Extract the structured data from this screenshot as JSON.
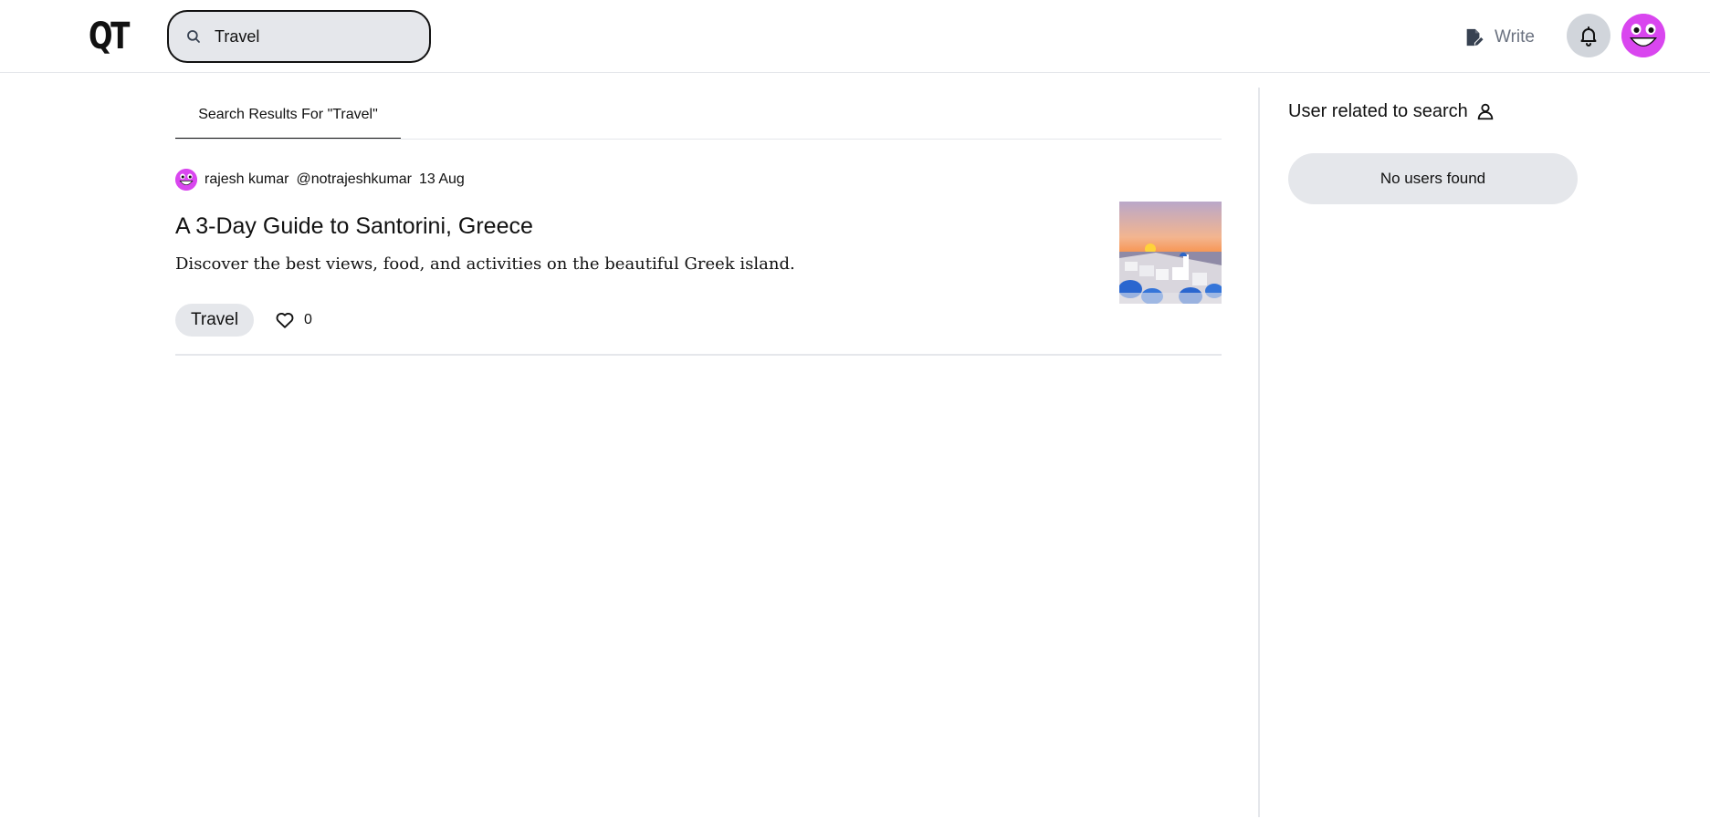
{
  "header": {
    "logo": "QT",
    "search": {
      "value": "Travel",
      "icon": "search-icon"
    },
    "write_label": "Write",
    "notifications_icon": "bell-icon",
    "avatar_icon": "smiley-avatar",
    "avatar_color": "#d946ef"
  },
  "main": {
    "tab_label": "Search Results For \"Travel\"",
    "post": {
      "author_name": "rajesh kumar",
      "author_handle": "@notrajeshkumar",
      "date": "13 Aug",
      "title": "A 3-Day Guide to Santorini, Greece",
      "description": "Discover the best views, food, and activities on the beautiful Greek island.",
      "tag": "Travel",
      "likes": "0"
    }
  },
  "sidebar": {
    "title": "User related to search",
    "empty_message": "No users found"
  }
}
